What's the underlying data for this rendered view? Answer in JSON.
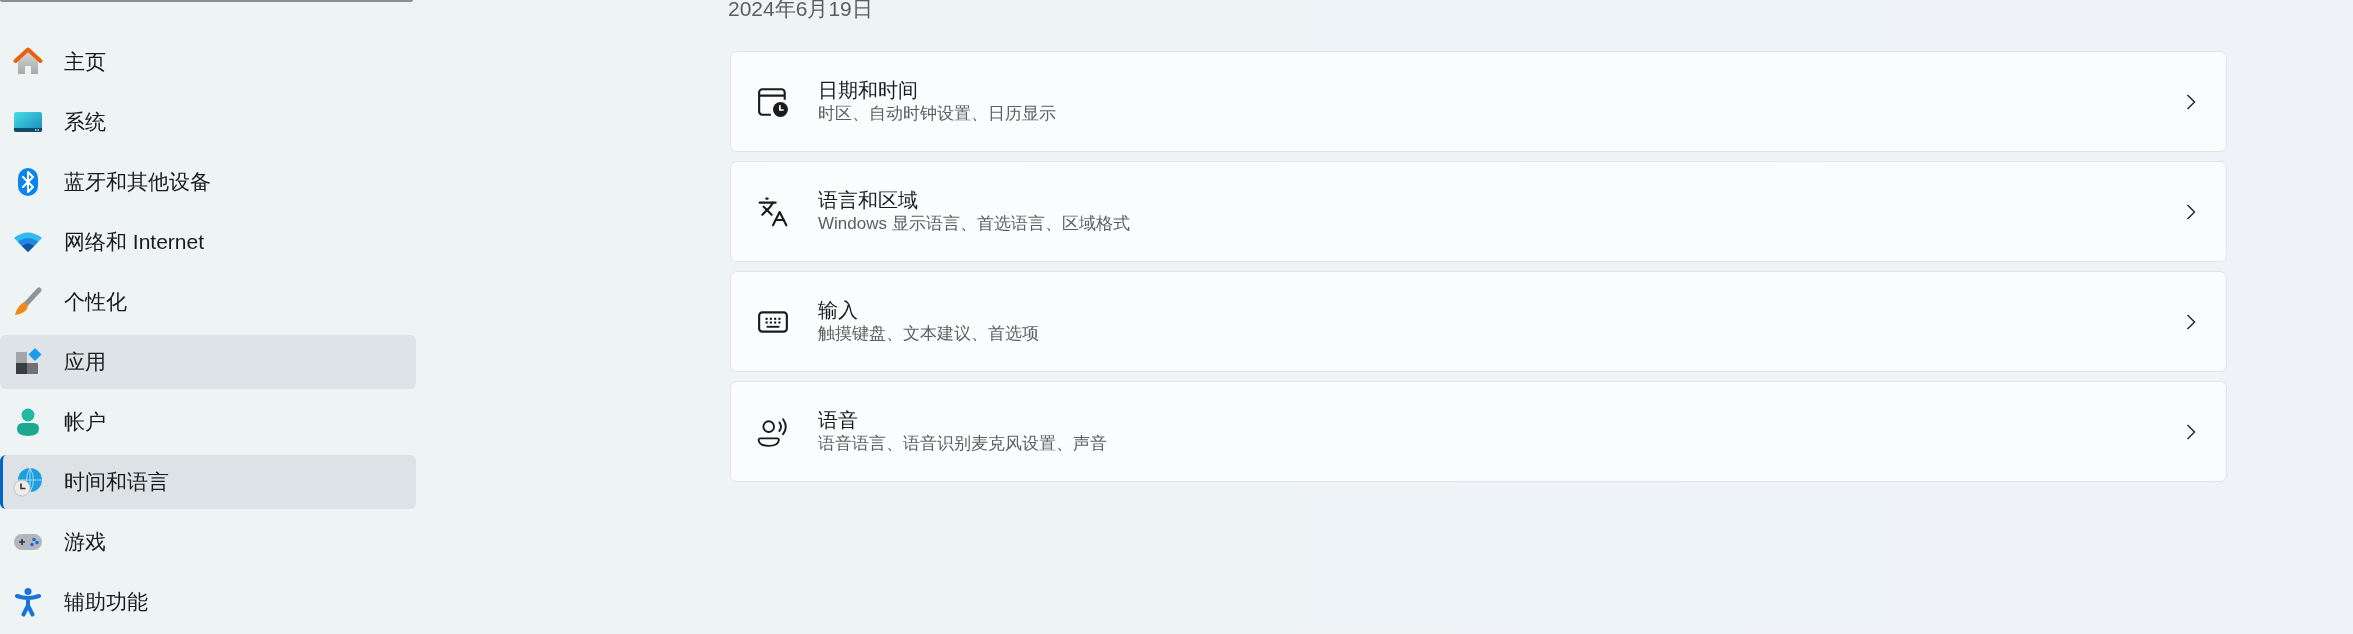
{
  "sidebar": {
    "items": [
      {
        "label": "主页",
        "selected": false,
        "hovered": false
      },
      {
        "label": "系统",
        "selected": false,
        "hovered": false
      },
      {
        "label": "蓝牙和其他设备",
        "selected": false,
        "hovered": false
      },
      {
        "label": "网络和 Internet",
        "selected": false,
        "hovered": false
      },
      {
        "label": "个性化",
        "selected": false,
        "hovered": false
      },
      {
        "label": "应用",
        "selected": false,
        "hovered": true
      },
      {
        "label": "帐户",
        "selected": false,
        "hovered": false
      },
      {
        "label": "时间和语言",
        "selected": true,
        "hovered": false
      },
      {
        "label": "游戏",
        "selected": false,
        "hovered": false
      },
      {
        "label": "辅助功能",
        "selected": false,
        "hovered": false
      }
    ]
  },
  "main": {
    "date": "2024年6月19日",
    "cards": [
      {
        "title": "日期和时间",
        "subtitle": "时区、自动时钟设置、日历显示"
      },
      {
        "title": "语言和区域",
        "subtitle": "Windows 显示语言、首选语言、区域格式"
      },
      {
        "title": "输入",
        "subtitle": "触摸键盘、文本建议、首选项"
      },
      {
        "title": "语音",
        "subtitle": "语音语言、语音识别麦克风设置、声音"
      }
    ]
  }
}
